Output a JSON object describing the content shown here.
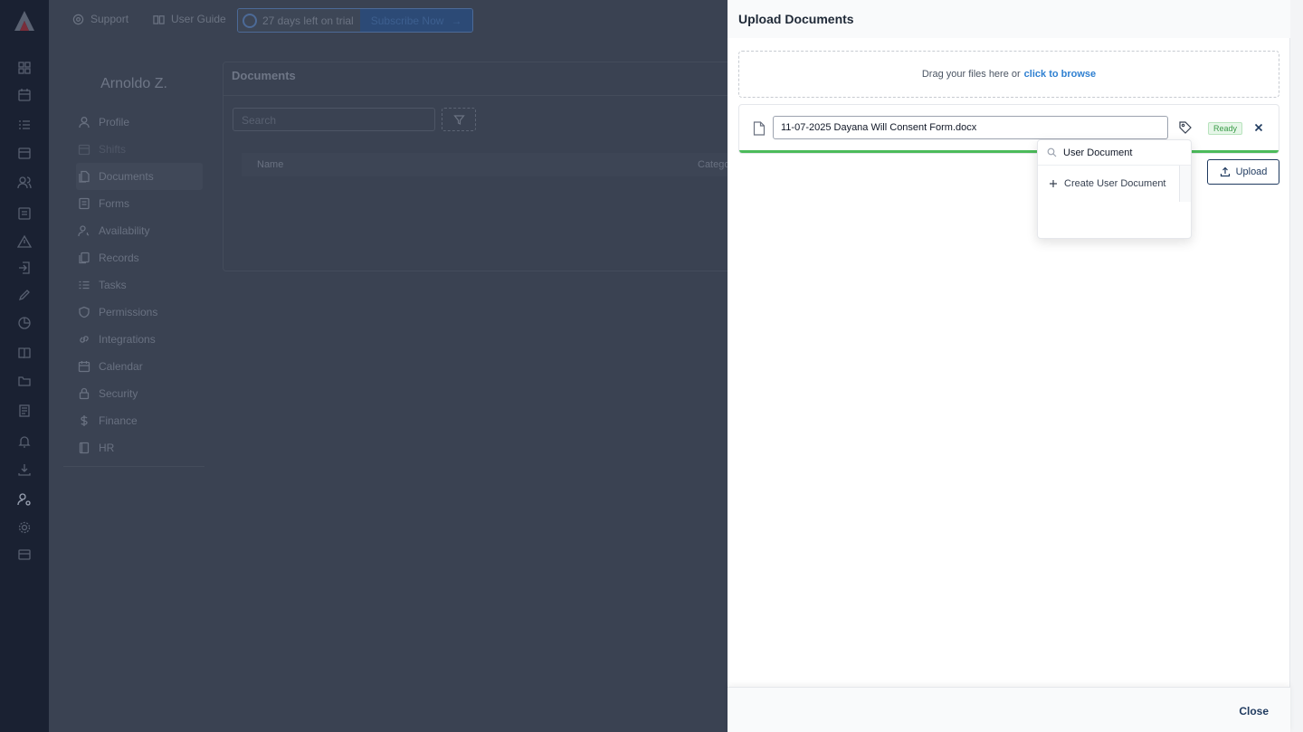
{
  "topbar": {
    "support_label": "Support",
    "guide_label": "User Guide",
    "trial_label": "27 days left on trial",
    "subscribe_label": "Subscribe Now",
    "subscribe_arrow": "→"
  },
  "profile": {
    "name": "Arnoldo Z.",
    "nav": [
      {
        "label": "Profile",
        "icon": "user-icon"
      },
      {
        "label": "Shifts",
        "icon": "calendar-icon"
      },
      {
        "label": "Documents",
        "icon": "documents-icon"
      },
      {
        "label": "Forms",
        "icon": "form-icon"
      },
      {
        "label": "Availability",
        "icon": "user-clock-icon"
      },
      {
        "label": "Records",
        "icon": "records-icon"
      },
      {
        "label": "Tasks",
        "icon": "tasks-icon"
      },
      {
        "label": "Permissions",
        "icon": "shield-icon"
      },
      {
        "label": "Integrations",
        "icon": "link-icon"
      },
      {
        "label": "Calendar",
        "icon": "calendar-icon"
      },
      {
        "label": "Security",
        "icon": "lock-icon"
      },
      {
        "label": "Finance",
        "icon": "dollar-icon"
      },
      {
        "label": "HR",
        "icon": "book-icon"
      }
    ]
  },
  "documents": {
    "title": "Documents",
    "search_placeholder": "Search",
    "columns": [
      "Name",
      "Category"
    ]
  },
  "drawer": {
    "title": "Upload Documents",
    "dropzone_text": "Drag your files here or",
    "dropzone_link": "click to browse",
    "file": {
      "name": "11-07-2025 Dayana Will Consent Form.docx",
      "status": "Ready",
      "progress": 1.0
    },
    "tag_search_value": "User Document",
    "tag_create_label": "Create User Document",
    "upload_label": "Upload",
    "close_label": "Close"
  },
  "colors": {
    "accent": "#1f3a5f",
    "link": "#2f80d1",
    "ready_green": "#3a9c48",
    "progress_green": "#4cbb5a"
  }
}
